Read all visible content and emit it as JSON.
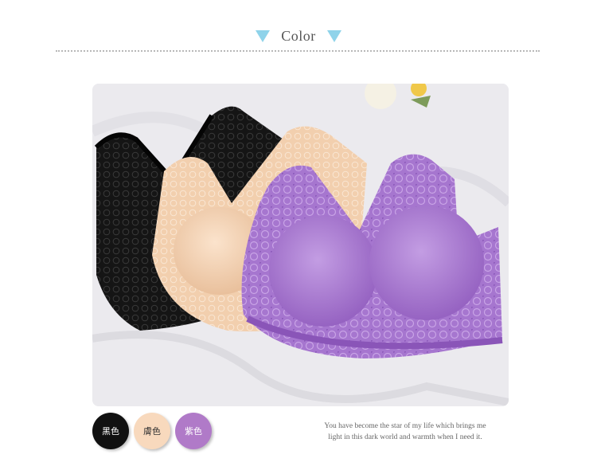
{
  "header": {
    "title": "Color",
    "accent": "#8fd3ea"
  },
  "swatches": [
    {
      "label": "黑色",
      "color": "#111111",
      "text_color": "#ffffff"
    },
    {
      "label": "膚色",
      "color": "#f8d9bd",
      "text_color": "#333333"
    },
    {
      "label": "紫色",
      "color": "#b07ac8",
      "text_color": "#ffffff"
    }
  ],
  "caption": {
    "line1": "You have become the star of my life which brings me",
    "line2": "light in this dark world and warmth when I need it."
  }
}
